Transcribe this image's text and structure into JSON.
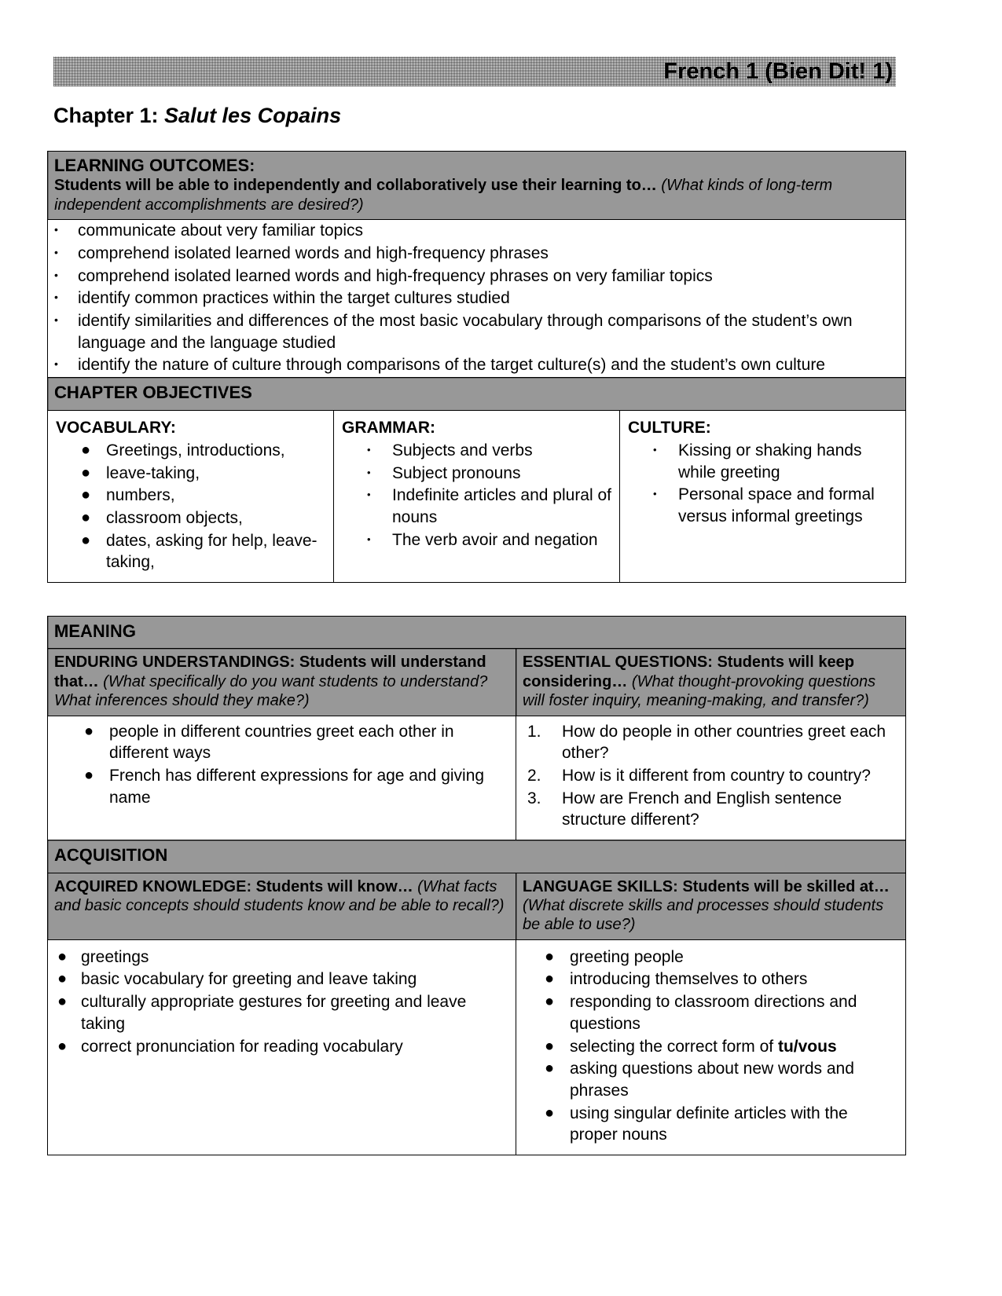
{
  "header": {
    "course_title": "French 1 (Bien Dit! 1)"
  },
  "chapter": {
    "label": "Chapter 1:",
    "name": "Salut les Copains"
  },
  "learning_outcomes": {
    "title": "LEARNING OUTCOMES:",
    "prompt_bold": "Students will be able to independently and collaboratively use their learning to…",
    "prompt_italic": "(What kinds of long-term independent accomplishments are desired?)",
    "items": [
      "communicate about very familiar topics",
      "comprehend isolated learned words and high-frequency phrases",
      "comprehend isolated learned words and high-frequency phrases on very familiar topics",
      "identify common practices within the target cultures studied",
      "identify similarities and differences of the most basic vocabulary through comparisons of the student’s own language and the language studied",
      "identify the nature of culture through comparisons of the target culture(s) and the student’s own culture"
    ]
  },
  "chapter_objectives": {
    "title": "CHAPTER OBJECTIVES",
    "vocabulary": {
      "heading": "VOCABULARY:",
      "items": [
        "Greetings, introductions,",
        "leave-taking,",
        "numbers,",
        " classroom objects,",
        " dates, asking for help, leave-taking,"
      ]
    },
    "grammar": {
      "heading": "GRAMMAR:",
      "items": [
        "Subjects and verbs",
        "Subject pronouns",
        "Indefinite articles and plural of nouns",
        "The verb avoir and negation"
      ]
    },
    "culture": {
      "heading": "CULTURE:",
      "items": [
        "Kissing or shaking hands while greeting",
        "Personal space and formal versus informal greetings"
      ]
    }
  },
  "meaning": {
    "title": "MEANING",
    "enduring": {
      "heading_bold": "ENDURING UNDERSTANDINGS: Students will understand that…",
      "heading_italic": "(What specifically do you want students to understand? What inferences should they make?)",
      "items": [
        "people in different countries greet each other in different ways",
        "French has different expressions for age and giving name"
      ]
    },
    "essential": {
      "heading_bold": "ESSENTIAL QUESTIONS: Students will keep considering…",
      "heading_italic": "(What thought-provoking questions will foster inquiry, meaning-making, and transfer?)",
      "items": [
        "How do people in other countries greet each other?",
        "How is it different from country to country?",
        "How are French and English sentence structure different?"
      ],
      "numbers": [
        "1.",
        "2.",
        "3."
      ]
    }
  },
  "acquisition": {
    "title": "ACQUISITION",
    "knowledge": {
      "heading_bold": "ACQUIRED KNOWLEDGE: Students will know…",
      "heading_italic": "(What facts and basic concepts should students know and be able to recall?)",
      "items": [
        "greetings",
        "basic vocabulary for greeting and leave taking",
        "culturally appropriate gestures for greeting and leave taking",
        "correct pronunciation for reading vocabulary"
      ]
    },
    "skills": {
      "heading_bold": "LANGUAGE SKILLS: Students will be skilled at…",
      "heading_italic": "(What discrete skills and processes should students be able to use?)",
      "items": [
        {
          "text": "greeting people"
        },
        {
          "text": "introducing themselves to others"
        },
        {
          "text": "responding to classroom directions and questions"
        },
        {
          "pre": "selecting the correct form of ",
          "bold": "tu/vous",
          "post": ""
        },
        {
          "text": "asking questions about new words and phrases"
        },
        {
          "text": "using singular definite articles with the proper nouns"
        }
      ]
    }
  },
  "glyphs": {
    "bullet_dot": "•",
    "bullet_filled": "●"
  }
}
